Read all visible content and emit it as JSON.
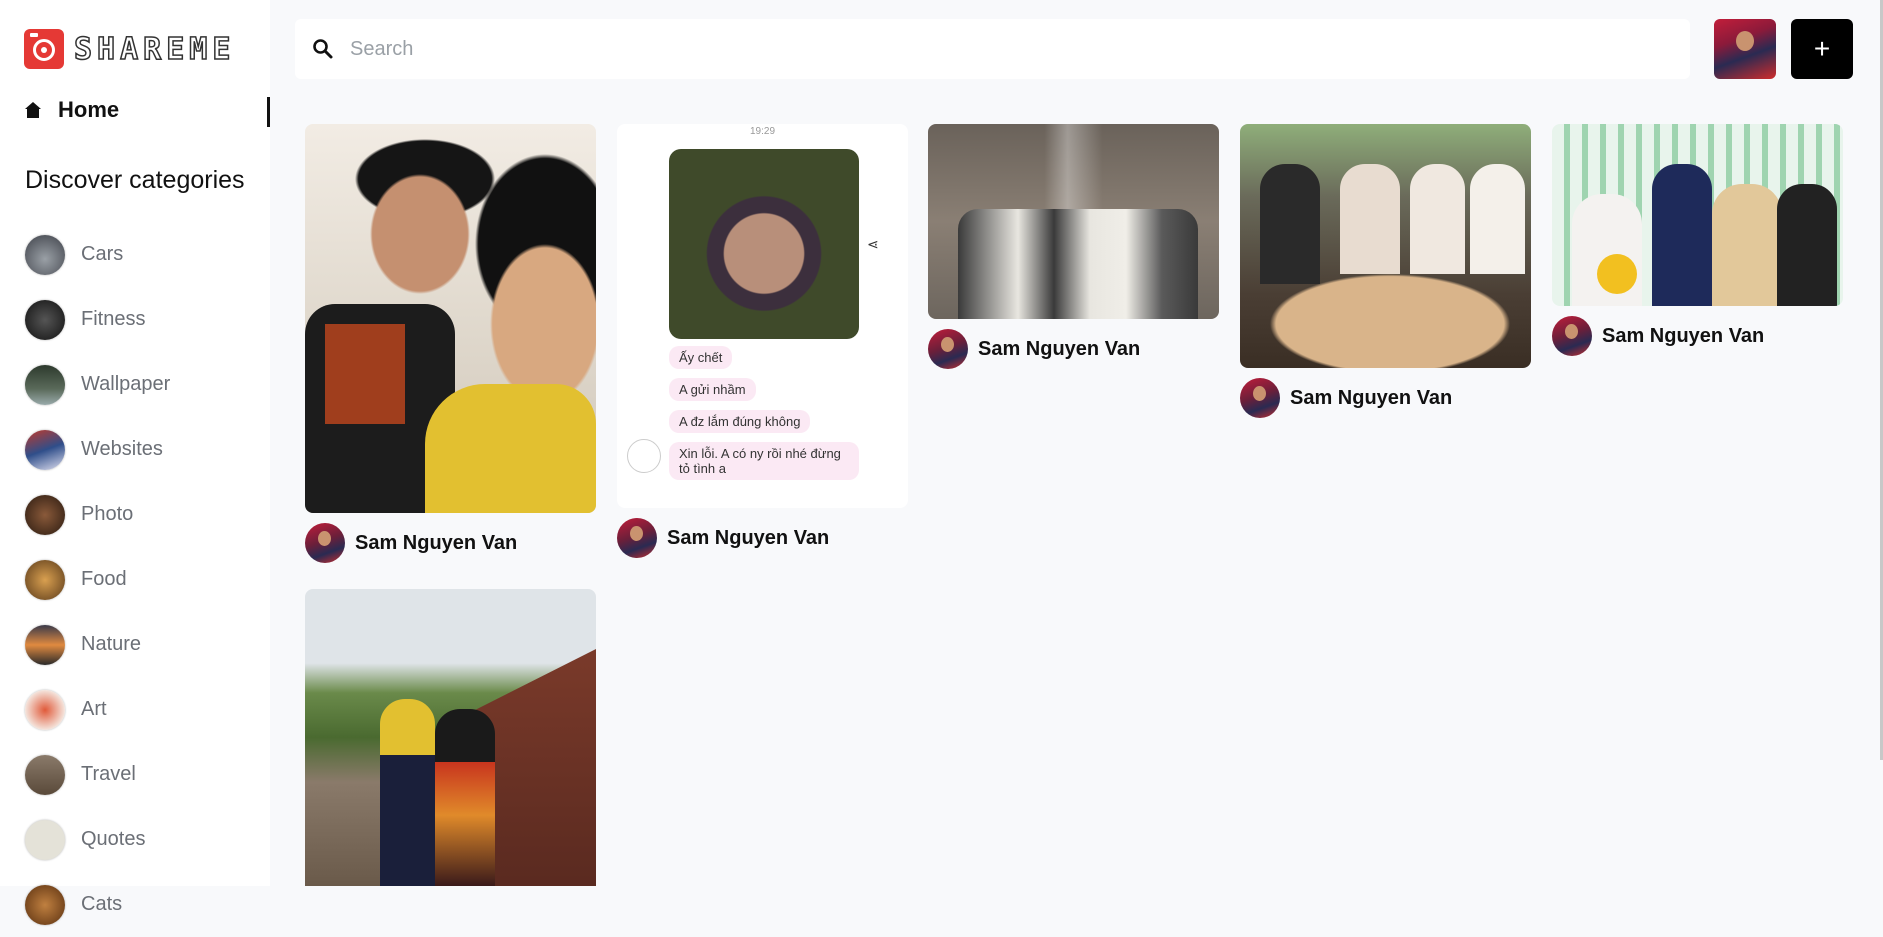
{
  "app": {
    "name": "SHAREME"
  },
  "sidebar": {
    "home_label": "Home",
    "discover_title": "Discover categories",
    "categories": [
      {
        "label": "Cars",
        "color": "#5b5f66"
      },
      {
        "label": "Fitness",
        "color": "#2d2d2d"
      },
      {
        "label": "Wallpaper",
        "color": "#3a4a3a"
      },
      {
        "label": "Websites",
        "color": "#2f4e8a"
      },
      {
        "label": "Photo",
        "color": "#4a3020"
      },
      {
        "label": "Food",
        "color": "#b07a3a"
      },
      {
        "label": "Nature",
        "color": "#7a5a3a"
      },
      {
        "label": "Art",
        "color": "#c8463a"
      },
      {
        "label": "Travel",
        "color": "#7a6a5a"
      },
      {
        "label": "Quotes",
        "color": "#d8d6cc"
      },
      {
        "label": "Cats",
        "color": "#8a5a2a"
      }
    ]
  },
  "search": {
    "placeholder": "Search",
    "value": ""
  },
  "header": {
    "add_label": "+"
  },
  "pins": [
    {
      "author": "Sam Nguyen Van"
    },
    {
      "author": "Sam Nguyen Van",
      "time": "19:29",
      "messages": [
        "Ấy chết",
        "A gửi nhầm",
        "A đz lắm đúng không",
        "Xin lỗi. A có ny rồi nhé đừng tỏ tình a"
      ]
    },
    {
      "author": "Sam Nguyen Van"
    },
    {
      "author": "Sam Nguyen Van"
    },
    {
      "author": "Sam Nguyen Van"
    },
    {
      "author": ""
    }
  ]
}
